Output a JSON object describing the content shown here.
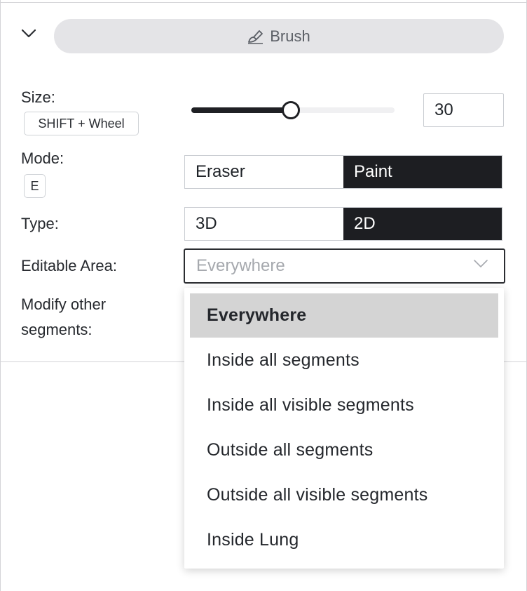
{
  "tool": {
    "label": "Brush",
    "icon": "brush-icon"
  },
  "collapse": {
    "icon": "chevron-down-icon"
  },
  "size": {
    "label": "Size:",
    "shortcut": "SHIFT + Wheel",
    "value": "30",
    "slider_fraction": 0.49
  },
  "mode": {
    "label": "Mode:",
    "shortcut": "E",
    "options": [
      "Eraser",
      "Paint"
    ],
    "selected": "Paint"
  },
  "type": {
    "label": "Type:",
    "options": [
      "3D",
      "2D"
    ],
    "selected": "2D"
  },
  "editable_area": {
    "label": "Editable Area:",
    "value": "Everywhere",
    "options": [
      "Everywhere",
      "Inside all segments",
      "Inside all visible segments",
      "Outside all segments",
      "Outside all visible segments",
      "Inside Lung"
    ]
  },
  "modify_other": {
    "label_line1": "Modify other",
    "label_line2": "segments:"
  },
  "colors": {
    "active": "#1d1e22",
    "pill": "#e4e4e7",
    "selected_option": "#d4d4d4"
  }
}
